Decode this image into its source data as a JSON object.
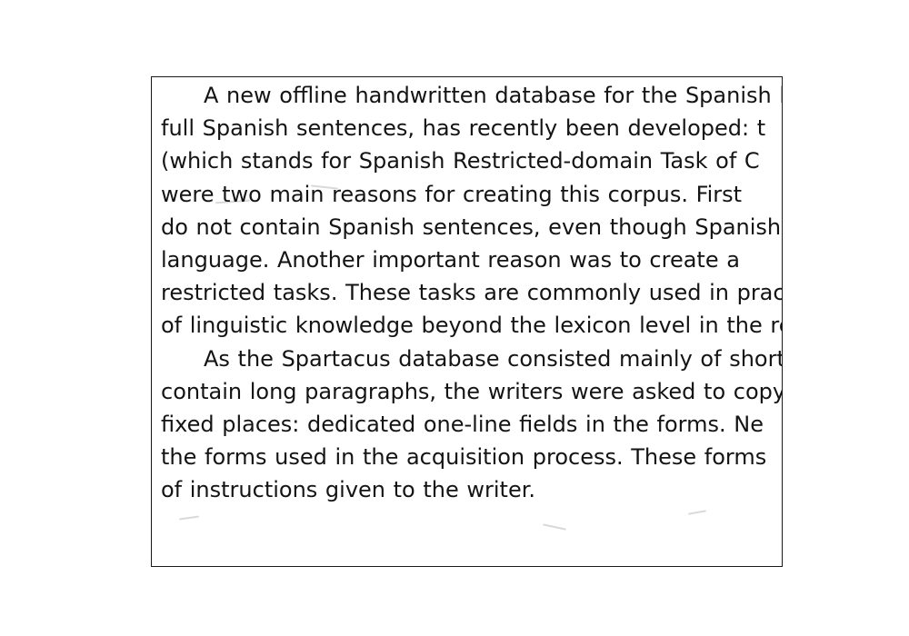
{
  "document": {
    "paragraphs": [
      {
        "lines": [
          "A new offline handwritten database for the Spanish la",
          "full Spanish sentences, has recently been developed: t",
          "(which stands for Spanish Restricted-domain Task of C",
          "were two main reasons for creating this corpus. First",
          "do not contain Spanish sentences, even though Spanish",
          "language. Another important reason was to create a",
          "restricted tasks. These tasks are commonly used in prac",
          "of linguistic knowledge beyond the lexicon level in the re"
        ]
      },
      {
        "lines": [
          "As the Spartacus database consisted mainly of short",
          "contain long paragraphs, the writers were asked to copy",
          "fixed places: dedicated one-line fields in the forms. Ne",
          "the forms used in the acquisition process. These forms",
          "of instructions given to the writer."
        ]
      }
    ]
  }
}
